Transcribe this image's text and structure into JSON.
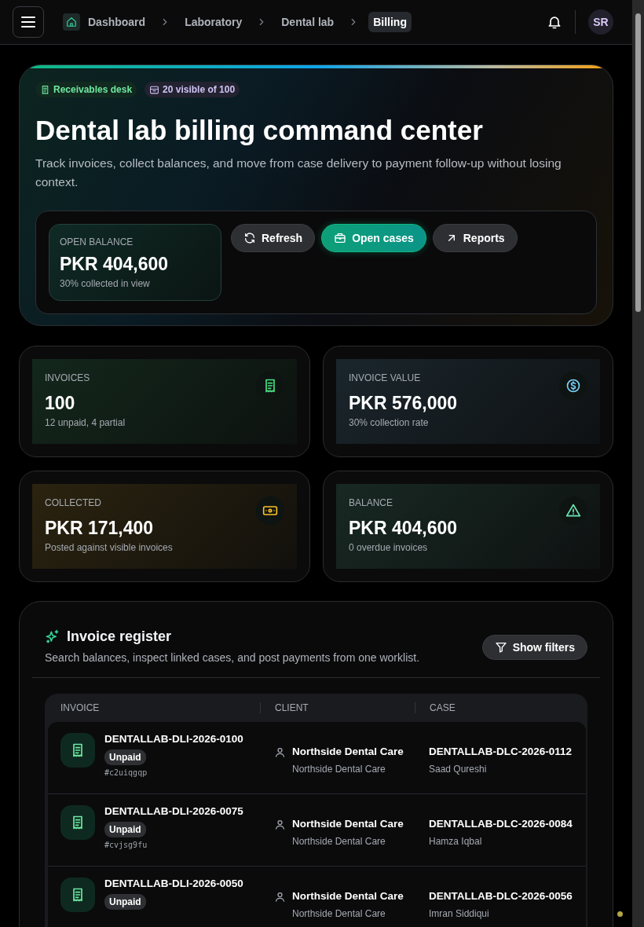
{
  "header": {
    "breadcrumbs": [
      {
        "label": "Dashboard",
        "selected": false
      },
      {
        "label": "Laboratory",
        "selected": false
      },
      {
        "label": "Dental lab",
        "selected": false
      },
      {
        "label": "Billing",
        "selected": true
      }
    ],
    "avatar": "SR"
  },
  "hero": {
    "chips": [
      {
        "label": "Receivables desk",
        "kind": "green"
      },
      {
        "label": "20 visible of 100",
        "kind": "violet"
      }
    ],
    "title": "Dental lab billing command center",
    "subtitle": "Track invoices, collect balances, and move from case delivery to payment follow-up without losing context.",
    "balance": {
      "label": "OPEN BALANCE",
      "value": "PKR 404,600",
      "note": "30% collected in view"
    },
    "actions": [
      {
        "label": "Refresh",
        "kind": "secondary"
      },
      {
        "label": "Open cases",
        "kind": "primary"
      },
      {
        "label": "Reports",
        "kind": "secondary"
      }
    ]
  },
  "stats": [
    {
      "label": "INVOICES",
      "value": "100",
      "note": "12 unpaid, 4 partial",
      "kind": "green"
    },
    {
      "label": "INVOICE VALUE",
      "value": "PKR 576,000",
      "note": "30% collection rate",
      "kind": "blue"
    },
    {
      "label": "COLLECTED",
      "value": "PKR 171,400",
      "note": "Posted against visible invoices",
      "kind": "amber"
    },
    {
      "label": "BALANCE",
      "value": "PKR 404,600",
      "note": "0 overdue invoices",
      "kind": "teal"
    }
  ],
  "register": {
    "title": "Invoice register",
    "subtitle": "Search balances, inspect linked cases, and post payments from one worklist.",
    "filter_button": "Show filters",
    "columns": [
      "INVOICE",
      "CLIENT",
      "CASE"
    ],
    "rows": [
      {
        "invoice": "DENTALLAB-DLI-2026-0100",
        "status": "Unpaid",
        "hash": "#c2uiqgqp",
        "client": "Northside Dental Care",
        "client_sub": "Northside Dental Care",
        "case": "DENTALLAB-DLC-2026-0112",
        "patient": "Saad Qureshi"
      },
      {
        "invoice": "DENTALLAB-DLI-2026-0075",
        "status": "Unpaid",
        "hash": "#cvjsg9fu",
        "client": "Northside Dental Care",
        "client_sub": "Northside Dental Care",
        "case": "DENTALLAB-DLC-2026-0084",
        "patient": "Hamza Iqbal"
      },
      {
        "invoice": "DENTALLAB-DLI-2026-0050",
        "status": "Unpaid",
        "client": "Northside Dental Care",
        "client_sub": "Northside Dental Care",
        "case": "DENTALLAB-DLC-2026-0056",
        "patient": "Imran Siddiqui"
      }
    ]
  }
}
